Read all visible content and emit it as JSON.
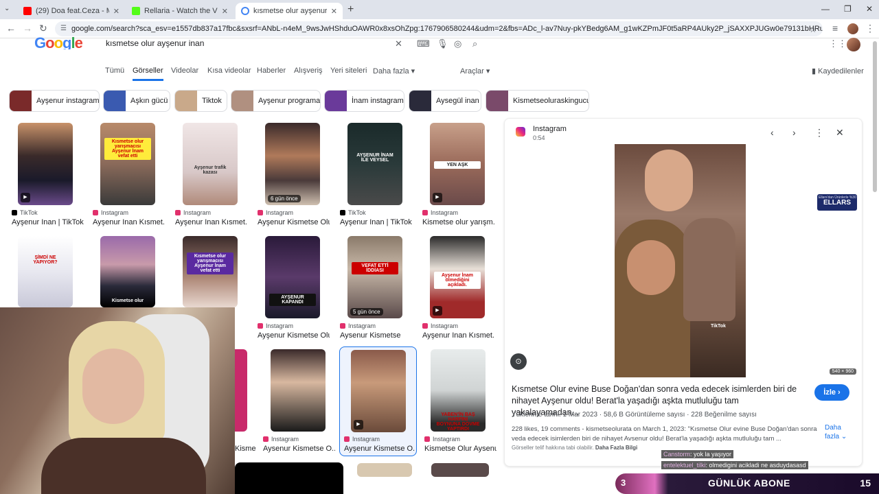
{
  "browser": {
    "tabs": [
      {
        "title": "(29) Doa feat.Ceza - Müziğin D...",
        "color": "#ff0000"
      },
      {
        "title": "Rellaria - Watch the VOD on Ki...",
        "color": "#53fc18"
      },
      {
        "title": "kısmetse olur ayşenur inan - Go...",
        "color": "#4285f4"
      }
    ],
    "new_tab": "+",
    "url": "google.com/search?sca_esv=e1557db837a17fbc&sxsrf=ANbL-n4eM_9wsJwHShduOAWR0x8xsOhZpg:1767906580244&udm=2&fbs=ADc_l-av7Nuy-pkYBedg6AM_g1wKZPmJF0t5aRP4AUky2P_jSAXXPJUGw0e79131bHRu5vWTbF2aoFIcUH8LO92vcJatSGfQEr_J..."
  },
  "google": {
    "logo": "Google",
    "query": "kısmetse olur ayşenur inan",
    "tabs": [
      "Tümü",
      "Görseller",
      "Videolar",
      "Kısa videolar",
      "Haberler",
      "Alışveriş",
      "Yeri siteleri",
      "Daha fazla ▾",
      "Araçlar ▾"
    ],
    "saved": "Kaydedilenler",
    "chips": [
      "Ayşenur instagram",
      "Aşkın gücü",
      "Tiktok",
      "Ayşenur programa",
      "İnam instagram",
      "Aysegül inan",
      "Kismetseoluraskingucu"
    ]
  },
  "results": [
    {
      "src": "TikTok",
      "cap": "Ayşenur Inan | TikTok",
      "overlay": "",
      "label": ""
    },
    {
      "src": "Instagram",
      "cap": "Ayşenur Inan Kısmet...",
      "overlay": "",
      "label": "Kısmetse olur yarışmacısı Ayşenur İnam vefat etti"
    },
    {
      "src": "Instagram",
      "cap": "Ayşenur Inan Kısmet...",
      "overlay": "",
      "label": "Ayşenur trafik kazası"
    },
    {
      "src": "Instagram",
      "cap": "Ayşenur Kismetse Olur",
      "overlay": "6 gün önce",
      "label": ""
    },
    {
      "src": "TikTok",
      "cap": "Ayşenur Inan | TikTok",
      "overlay": "",
      "label": "AYŞENUR İNAM İLE VEYSEL"
    },
    {
      "src": "Instagram",
      "cap": "Kismetse olur yarışm...",
      "overlay": "",
      "label": "YEN AŞK"
    },
    {
      "src": "",
      "cap": "",
      "overlay": "",
      "label": "ŞİMDİ NE YAPIYOR?"
    },
    {
      "src": "",
      "cap": "",
      "overlay": "",
      "label": "Kismetse olur"
    },
    {
      "src": "",
      "cap": "",
      "overlay": "",
      "label": "Kısmetse olur yarışmacısı Ayşenur İnam vefat etti"
    },
    {
      "src": "Instagram",
      "cap": "Ayşenur Kismetse Olur",
      "overlay": "",
      "label": "AYŞENUR KAPANDI"
    },
    {
      "src": "Instagram",
      "cap": "Aysenur Kismetse",
      "overlay": "5 gün önce",
      "label": "VEFAT ETTİ İDDİASI"
    },
    {
      "src": "Instagram",
      "cap": "Ayşenur Inan Kısmet...",
      "overlay": "",
      "label": "Ayşenur İnam ölmediğini açıkladı."
    },
    {
      "src": "",
      "cap": "Kismetse o...",
      "overlay": "",
      "label": ""
    },
    {
      "src": "",
      "cap": "",
      "overlay": "",
      "label": ""
    },
    {
      "src": "Instagram",
      "cap": "Aysenur Kismetse O...",
      "overlay": "",
      "label": ""
    },
    {
      "src": "Instagram",
      "cap": "Ayşenur Kismetse O...",
      "overlay": "",
      "label": ""
    },
    {
      "src": "Instagram",
      "cap": "Kismetse Olur Aysenur",
      "overlay": "",
      "label": "YABEN'İN BAŞ HARFİNİ BOYNUNA DÖVME YAPTIRDI"
    }
  ],
  "preview": {
    "source": "Instagram",
    "duration": "0:54",
    "dims": "540 × 960",
    "headline": "Kısmetse Olur evine Buse Doğan'dan sonra veda edecek isimlerden biri de nihayet Ayşenur oldu! Berat'la yaşadığı aşkta mutluluğu tam yakalayamadan...",
    "watch": "İzle ›",
    "meta": "Yüklenme tarihi: 1 Mar 2023 · 58,6 B Görüntüleme sayısı · 228 Beğenilme sayısı",
    "desc": "228 likes, 19 comments - kismetseolurata on March 1, 2023: \"Kısmetse Olur evine Buse Doğan'dan sonra veda edecek isimlerden biri de nihayet Avsenur oldu! Berat'la yaşadığı aşkta mutluluğu tam ...",
    "more": "Daha fazla",
    "copyright": "Görseller telif hakkına tabi olabilir.",
    "copyright_link": "Daha Fazla Bilgi",
    "tiktok_mark": "TikTok"
  },
  "stream": {
    "chat": [
      {
        "user": "Canstorm",
        "msg": ": yok la yaşıyor"
      },
      {
        "user": "entelektuel_tilki",
        "msg": ": olmedigini acikladi ne asduydasasd"
      }
    ],
    "goal_current": "3",
    "goal_label": "GÜNLÜK ABONE",
    "goal_target": "15",
    "sponsor": "ELLARS",
    "sponsor_small": "Ellars'dan Ürünlerle %30 İndirim Kodu"
  }
}
